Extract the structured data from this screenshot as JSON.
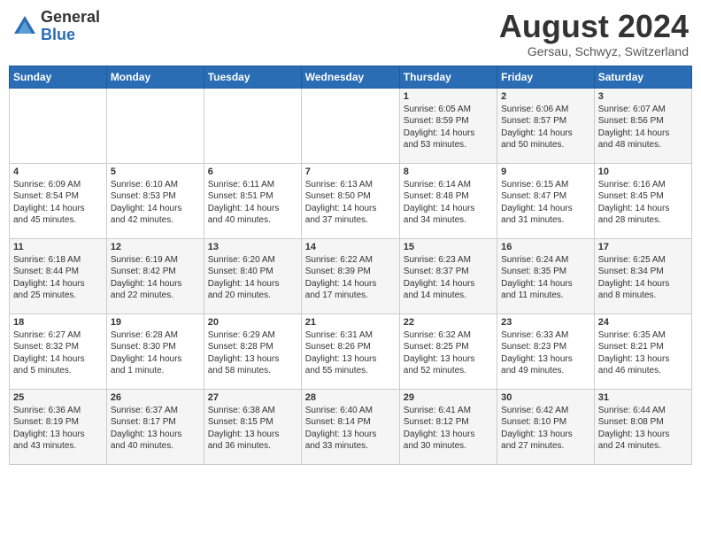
{
  "header": {
    "logo_general": "General",
    "logo_blue": "Blue",
    "month_title": "August 2024",
    "location": "Gersau, Schwyz, Switzerland"
  },
  "days_of_week": [
    "Sunday",
    "Monday",
    "Tuesday",
    "Wednesday",
    "Thursday",
    "Friday",
    "Saturday"
  ],
  "weeks": [
    [
      {
        "day": "",
        "info": ""
      },
      {
        "day": "",
        "info": ""
      },
      {
        "day": "",
        "info": ""
      },
      {
        "day": "",
        "info": ""
      },
      {
        "day": "1",
        "info": "Sunrise: 6:05 AM\nSunset: 8:59 PM\nDaylight: 14 hours\nand 53 minutes."
      },
      {
        "day": "2",
        "info": "Sunrise: 6:06 AM\nSunset: 8:57 PM\nDaylight: 14 hours\nand 50 minutes."
      },
      {
        "day": "3",
        "info": "Sunrise: 6:07 AM\nSunset: 8:56 PM\nDaylight: 14 hours\nand 48 minutes."
      }
    ],
    [
      {
        "day": "4",
        "info": "Sunrise: 6:09 AM\nSunset: 8:54 PM\nDaylight: 14 hours\nand 45 minutes."
      },
      {
        "day": "5",
        "info": "Sunrise: 6:10 AM\nSunset: 8:53 PM\nDaylight: 14 hours\nand 42 minutes."
      },
      {
        "day": "6",
        "info": "Sunrise: 6:11 AM\nSunset: 8:51 PM\nDaylight: 14 hours\nand 40 minutes."
      },
      {
        "day": "7",
        "info": "Sunrise: 6:13 AM\nSunset: 8:50 PM\nDaylight: 14 hours\nand 37 minutes."
      },
      {
        "day": "8",
        "info": "Sunrise: 6:14 AM\nSunset: 8:48 PM\nDaylight: 14 hours\nand 34 minutes."
      },
      {
        "day": "9",
        "info": "Sunrise: 6:15 AM\nSunset: 8:47 PM\nDaylight: 14 hours\nand 31 minutes."
      },
      {
        "day": "10",
        "info": "Sunrise: 6:16 AM\nSunset: 8:45 PM\nDaylight: 14 hours\nand 28 minutes."
      }
    ],
    [
      {
        "day": "11",
        "info": "Sunrise: 6:18 AM\nSunset: 8:44 PM\nDaylight: 14 hours\nand 25 minutes."
      },
      {
        "day": "12",
        "info": "Sunrise: 6:19 AM\nSunset: 8:42 PM\nDaylight: 14 hours\nand 22 minutes."
      },
      {
        "day": "13",
        "info": "Sunrise: 6:20 AM\nSunset: 8:40 PM\nDaylight: 14 hours\nand 20 minutes."
      },
      {
        "day": "14",
        "info": "Sunrise: 6:22 AM\nSunset: 8:39 PM\nDaylight: 14 hours\nand 17 minutes."
      },
      {
        "day": "15",
        "info": "Sunrise: 6:23 AM\nSunset: 8:37 PM\nDaylight: 14 hours\nand 14 minutes."
      },
      {
        "day": "16",
        "info": "Sunrise: 6:24 AM\nSunset: 8:35 PM\nDaylight: 14 hours\nand 11 minutes."
      },
      {
        "day": "17",
        "info": "Sunrise: 6:25 AM\nSunset: 8:34 PM\nDaylight: 14 hours\nand 8 minutes."
      }
    ],
    [
      {
        "day": "18",
        "info": "Sunrise: 6:27 AM\nSunset: 8:32 PM\nDaylight: 14 hours\nand 5 minutes."
      },
      {
        "day": "19",
        "info": "Sunrise: 6:28 AM\nSunset: 8:30 PM\nDaylight: 14 hours\nand 1 minute."
      },
      {
        "day": "20",
        "info": "Sunrise: 6:29 AM\nSunset: 8:28 PM\nDaylight: 13 hours\nand 58 minutes."
      },
      {
        "day": "21",
        "info": "Sunrise: 6:31 AM\nSunset: 8:26 PM\nDaylight: 13 hours\nand 55 minutes."
      },
      {
        "day": "22",
        "info": "Sunrise: 6:32 AM\nSunset: 8:25 PM\nDaylight: 13 hours\nand 52 minutes."
      },
      {
        "day": "23",
        "info": "Sunrise: 6:33 AM\nSunset: 8:23 PM\nDaylight: 13 hours\nand 49 minutes."
      },
      {
        "day": "24",
        "info": "Sunrise: 6:35 AM\nSunset: 8:21 PM\nDaylight: 13 hours\nand 46 minutes."
      }
    ],
    [
      {
        "day": "25",
        "info": "Sunrise: 6:36 AM\nSunset: 8:19 PM\nDaylight: 13 hours\nand 43 minutes."
      },
      {
        "day": "26",
        "info": "Sunrise: 6:37 AM\nSunset: 8:17 PM\nDaylight: 13 hours\nand 40 minutes."
      },
      {
        "day": "27",
        "info": "Sunrise: 6:38 AM\nSunset: 8:15 PM\nDaylight: 13 hours\nand 36 minutes."
      },
      {
        "day": "28",
        "info": "Sunrise: 6:40 AM\nSunset: 8:14 PM\nDaylight: 13 hours\nand 33 minutes."
      },
      {
        "day": "29",
        "info": "Sunrise: 6:41 AM\nSunset: 8:12 PM\nDaylight: 13 hours\nand 30 minutes."
      },
      {
        "day": "30",
        "info": "Sunrise: 6:42 AM\nSunset: 8:10 PM\nDaylight: 13 hours\nand 27 minutes."
      },
      {
        "day": "31",
        "info": "Sunrise: 6:44 AM\nSunset: 8:08 PM\nDaylight: 13 hours\nand 24 minutes."
      }
    ]
  ]
}
